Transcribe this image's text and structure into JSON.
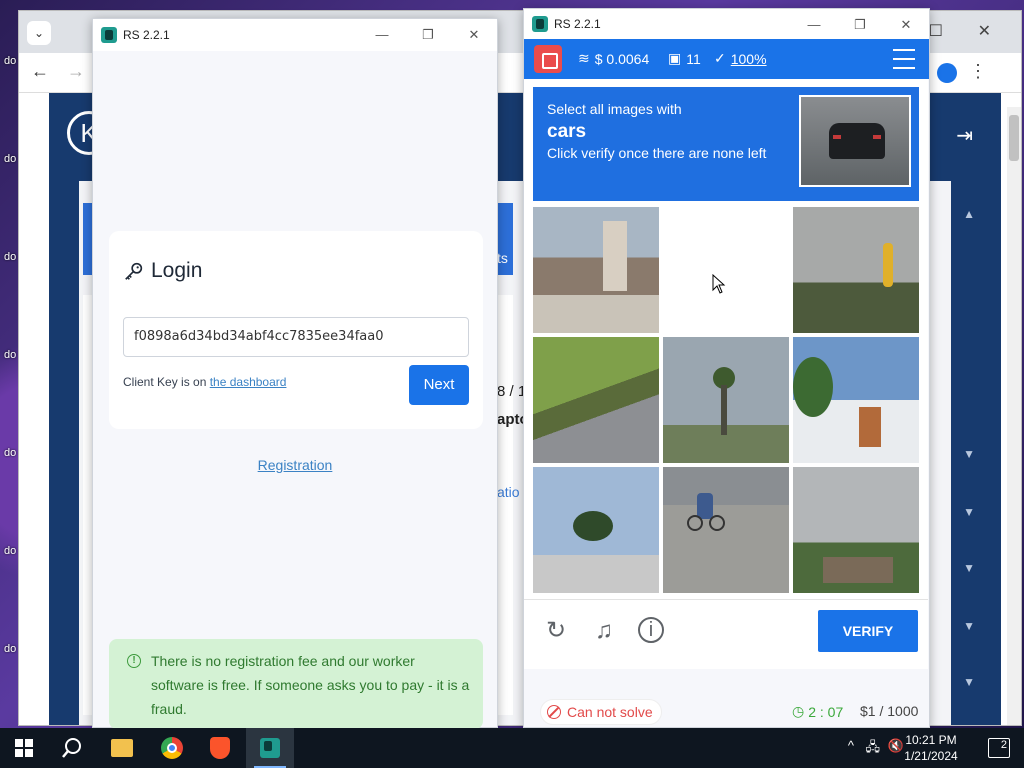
{
  "desktop": {
    "icon_labels": [
      "do",
      "do",
      "do",
      "do",
      "do",
      "do",
      "do"
    ]
  },
  "browser": {
    "peek_texts": [
      "8 / 1",
      "apto",
      "atio",
      "ts"
    ]
  },
  "login_window": {
    "title": "RS 2.2.1",
    "heading": "Login",
    "client_key_value": "f0898a6d34bd34abf4cc7835ee34faa0",
    "hint_prefix": "Client Key is on",
    "hint_link": "the dashboard",
    "next_label": "Next",
    "registration_link": "Registration",
    "notice": "There is no registration fee and our worker software is free. If someone asks you to pay - it is a fraud."
  },
  "captcha_window": {
    "title": "RS 2.2.1",
    "balance": "$ 0.0064",
    "images_count": "11",
    "success_rate": "100%",
    "prompt_line1": "Select all images with",
    "prompt_target": "cars",
    "prompt_line3": "Click verify once there are none left",
    "verify_label": "VERIFY",
    "cant_solve": "Can not solve",
    "timer": "2 : 07",
    "quota": "$1 / 1000",
    "tiles": [
      "roof-chimney",
      "empty",
      "street-lamp-sign",
      "grass-road",
      "palm-tree",
      "palm-building",
      "palm-roof",
      "cyclist",
      "trees-house"
    ]
  },
  "taskbar": {
    "time": "10:21 PM",
    "date": "1/21/2024",
    "notifications": "2"
  },
  "colors": {
    "accent": "#1a73e8",
    "notice_bg": "#d4f2d4",
    "danger": "#e24a4a",
    "success": "#3aa83a"
  }
}
